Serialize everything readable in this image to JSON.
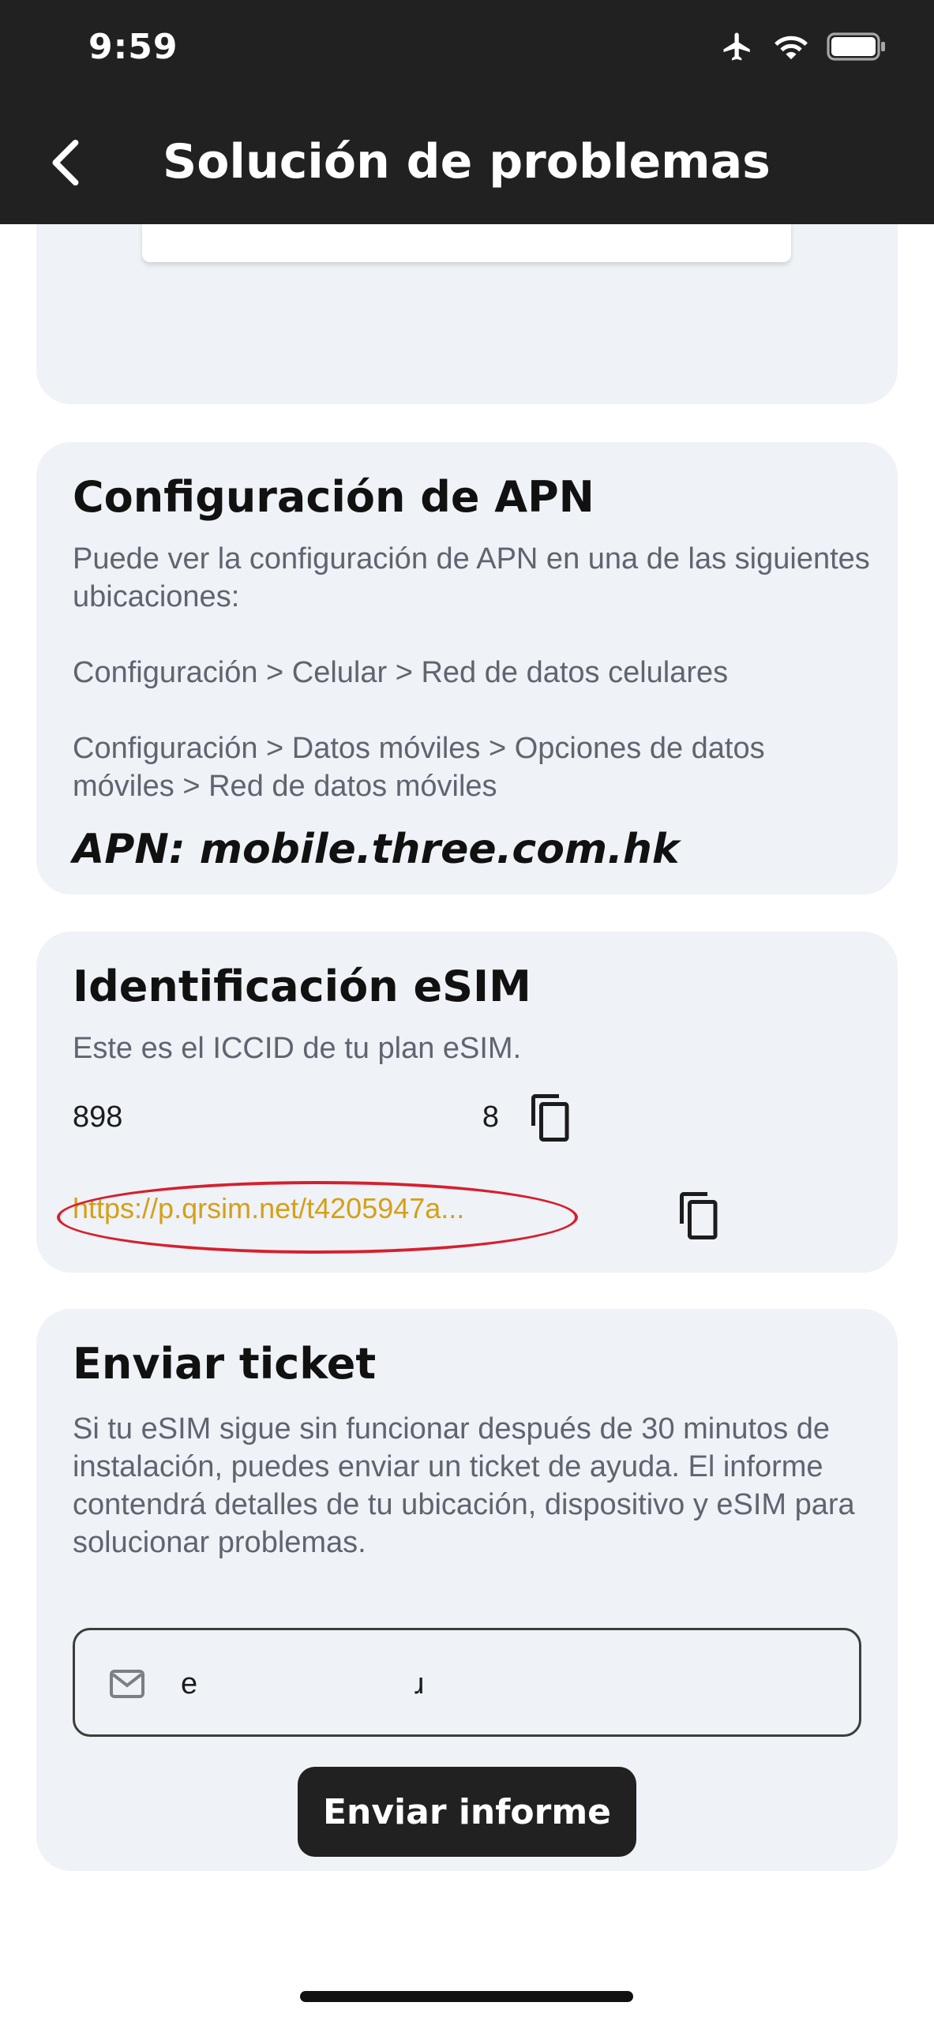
{
  "status_bar": {
    "time": "9:59"
  },
  "nav": {
    "title": "Solución de problemas"
  },
  "apn_section": {
    "title": "Configuración de APN",
    "intro": "Puede ver la configuración de APN en una de las siguientes ubicaciones:",
    "path_1": "Configuración > Celular > Red de datos celulares",
    "path_2": "Configuración > Datos móviles > Opciones de datos móviles > Red de datos móviles",
    "apn_value": "APN: mobile.three.com.hk"
  },
  "esim_section": {
    "title": "Identificación eSIM",
    "description": "Este es el ICCID de tu plan eSIM.",
    "iccid_start": "898",
    "iccid_end": "8",
    "link": "https://p.qrsim.net/t4205947a..."
  },
  "ticket_section": {
    "title": "Enviar ticket",
    "description": "Si tu eSIM sigue sin funcionar después de 30 minutos de instalación, puedes enviar un ticket de ayuda. El informe contendrá detalles de tu ubicación, dispositivo y eSIM para solucionar problemas.",
    "email_value": "e                          ɹ",
    "send_label": "Enviar informe"
  },
  "colors": {
    "header_bg": "#212121",
    "card_bg": "#eff2f6",
    "link": "#d4a017",
    "annotation": "#d5202f"
  },
  "icons": [
    "airplane-icon",
    "wifi-icon",
    "battery-icon",
    "chevron-left-icon",
    "copy-icon",
    "mail-icon"
  ]
}
